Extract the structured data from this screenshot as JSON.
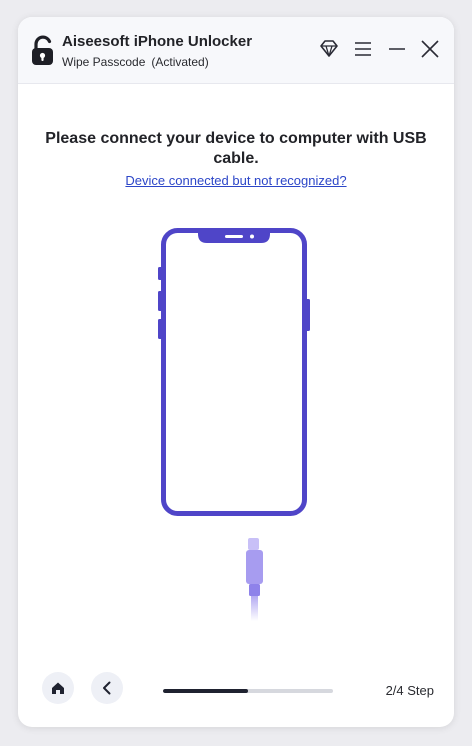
{
  "app": {
    "title": "Aiseesoft iPhone Unlocker",
    "mode": "Wipe Passcode",
    "status": "(Activated)"
  },
  "titlebar_icons": [
    "diamond-icon",
    "menu-icon",
    "minimize-icon",
    "close-icon"
  ],
  "main": {
    "heading": "Please connect your device to computer with USB cable.",
    "help_link": "Device connected but not recognized?"
  },
  "footer": {
    "step_label": "2/4 Step",
    "progress": 0.5
  },
  "colors": {
    "accent": "#4f45c8",
    "cable": "#a79cf0",
    "link": "#2c46c8",
    "text": "#222328"
  }
}
